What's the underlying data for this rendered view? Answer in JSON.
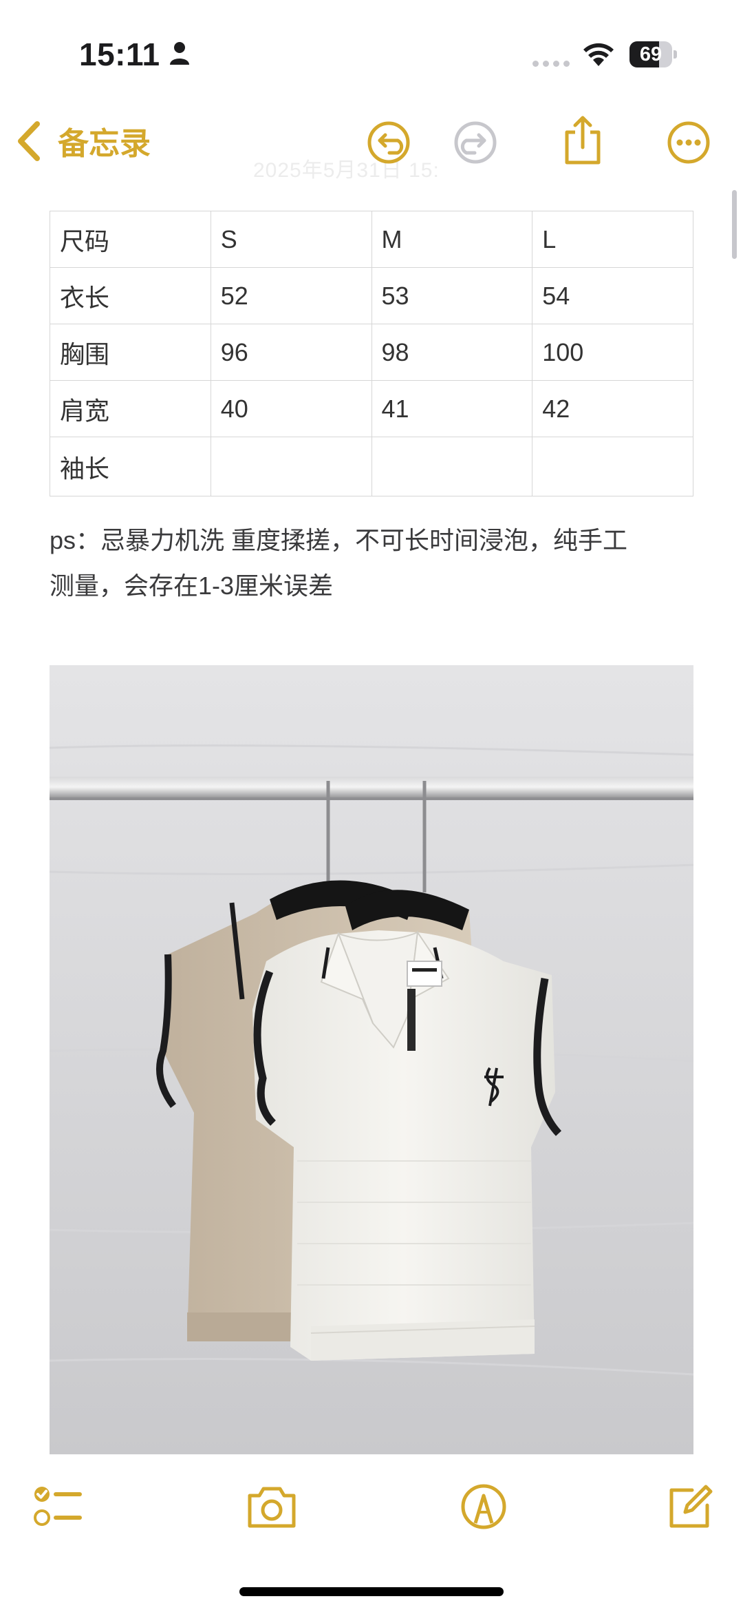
{
  "status_bar": {
    "time": "15:11",
    "battery_percent": "69",
    "battery_level": 0.69
  },
  "nav": {
    "back_label": "备忘录",
    "faded_date": "2025年5月31日 15:"
  },
  "table": {
    "rows": [
      [
        "尺码",
        "S",
        "M",
        "L"
      ],
      [
        "衣长",
        "52",
        "53",
        "54"
      ],
      [
        "胸围",
        "96",
        "98",
        "100"
      ],
      [
        "肩宽",
        "40",
        "41",
        "42"
      ],
      [
        "袖长",
        "",
        "",
        ""
      ]
    ]
  },
  "note": {
    "line1": "ps：忌暴力机洗 重度揉搓，不可长时间浸泡，纯手工",
    "line2": "测量，会存在1-3厘米误差"
  },
  "icons": {
    "back": "chevron-left-icon",
    "undo": "undo-icon",
    "redo": "redo-icon",
    "share": "share-icon",
    "more": "more-icon",
    "checklist": "checklist-icon",
    "camera": "camera-icon",
    "markup": "markup-icon",
    "compose": "compose-icon"
  },
  "colors": {
    "accent": "#d4a82c",
    "disabled": "#c7c7cc"
  }
}
